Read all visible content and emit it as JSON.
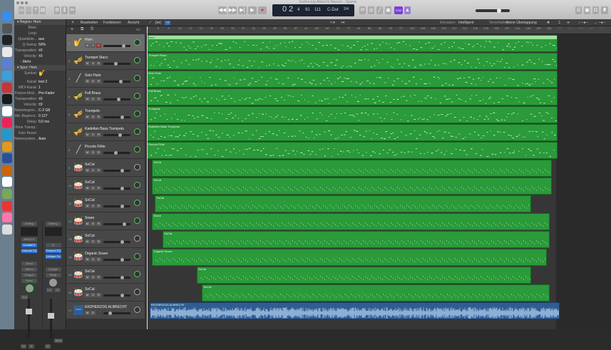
{
  "window": {
    "title": "Erzherzog Albrecht Marsch - Spuren"
  },
  "dock": {
    "icons": [
      "finder-icon",
      "system-preferences-icon",
      "app-icon",
      "app-icon",
      "app-icon",
      "app-icon",
      "app-icon",
      "app-icon",
      "app-icon",
      "app-icon",
      "app-icon",
      "app-icon",
      "app-icon",
      "app-icon",
      "app-icon",
      "app-icon",
      "app-icon",
      "app-icon",
      "trash-icon"
    ]
  },
  "transport": {
    "bar": "0",
    "beat": "2",
    "div": "4",
    "tick": "91",
    "tempo": "111",
    "key": "C-Dur",
    "signature": "2/4",
    "count_in": "1234"
  },
  "menu": {
    "edit": "Bearbeiten",
    "functions": "Funktionen",
    "view": "Ansicht",
    "snap_label": "Einrasten:",
    "snap_value": "Intelligent",
    "drag_label": "Verschieben:",
    "drag_value": "Keine Überlappung"
  },
  "inspector": {
    "region_header": "Region: Horn",
    "region_rows": [
      {
        "label": "Mute:",
        "value": ""
      },
      {
        "label": "Loop:",
        "value": ""
      },
      {
        "label": "Quantisier...",
        "value": "aus"
      },
      {
        "label": "Q-Swing:",
        "value": "50%"
      },
      {
        "label": "Transposition:",
        "value": "±0"
      },
      {
        "label": "Velocity:",
        "value": "±0"
      }
    ],
    "more": "Mehr",
    "track_header": "Spur: Horn",
    "track_rows": [
      {
        "label": "Symbol:",
        "value": ""
      },
      {
        "label": "Kanal:",
        "value": "Inst 2"
      },
      {
        "label": "MIDI-Kanal:",
        "value": "1"
      },
      {
        "label": "Freeze-Mod...",
        "value": "Pre-Fader"
      },
      {
        "label": "Transposition:",
        "value": "±0"
      },
      {
        "label": "Velocity:",
        "value": "±0"
      },
      {
        "label": "Notenbegren...",
        "value": "C-2   G8"
      },
      {
        "label": "Vel.-Begrenz.:",
        "value": "0   127"
      },
      {
        "label": "Delay:",
        "value": "0,0 ms"
      },
      {
        "label": "Ohne Transp.:",
        "value": ""
      },
      {
        "label": "Kein Reset:",
        "value": ""
      },
      {
        "label": "Notensystem...",
        "value": "Auto"
      }
    ],
    "strip1": {
      "setting": "Setting",
      "midi_fx": "MIDI-FX",
      "plugin1": "Kontakt 5",
      "plugin2": "Channel EQ",
      "send": "Send",
      "output": "Stereo",
      "group": "Gruppe",
      "automation": "Read",
      "vol": "-5,8",
      "pan": "",
      "mute": "M",
      "solo": "S"
    },
    "strip2": {
      "setting": "Setting",
      "plugin1": "Channel EQ",
      "plugin2": "(Unique Ou",
      "group": "Gruppe",
      "automation": "Read",
      "vol": "0,0",
      "pan": "-15",
      "mute": "M",
      "bounce": "Bnce"
    }
  },
  "ruler": [
    "1",
    "5",
    "9",
    "13",
    "17",
    "21",
    "25",
    "29",
    "33",
    "37",
    "41",
    "45",
    "49",
    "53",
    "57",
    "61",
    "65",
    "69",
    "73",
    "77",
    "81",
    "85",
    "89",
    "93",
    "97",
    "101",
    "105",
    "109",
    "113",
    "117",
    "121",
    "125",
    "129",
    "133",
    "137",
    "141",
    "145",
    "149",
    "153",
    "157",
    "161",
    "165",
    "169",
    "173"
  ],
  "tracks": [
    {
      "num": "2",
      "name": "Horn",
      "icon": "🎷",
      "type": "midi",
      "vol": 0.75,
      "pan_active": true,
      "rec": true,
      "selected": true,
      "region": {
        "name": "Horn",
        "start": 1,
        "end": 156
      }
    },
    {
      "num": "3",
      "name": "Trumpet Stacc",
      "icon": "🎺",
      "type": "midi",
      "vol": 0.45,
      "pan_active": true,
      "region": {
        "name": "Trumpet Stacc",
        "start": 1,
        "end": 156
      }
    },
    {
      "num": "4",
      "name": "Solo Flute",
      "icon": "╱",
      "type": "midi",
      "vol": 0.65,
      "pan_active": true,
      "region": {
        "name": "Solo Flute",
        "start": 1,
        "end": 156
      }
    },
    {
      "num": "5",
      "name": "Full Brass",
      "icon": "🎺",
      "type": "midi",
      "vol": 0.55,
      "pan_active": true,
      "region": {
        "name": "Full Brass",
        "start": 1,
        "end": 156
      }
    },
    {
      "num": "6",
      "name": "Trumpets",
      "icon": "🎺",
      "type": "midi",
      "vol": 0.7,
      "pan_active": true,
      "region": {
        "name": "Trumpets",
        "start": 1,
        "end": 156
      }
    },
    {
      "num": "7",
      "name": "Kadetten Bass Trumpets",
      "icon": "🎺",
      "type": "midi",
      "vol": 0.62,
      "pan_active": true,
      "region": {
        "name": "Kadetten Bass Trumpets",
        "start": 1,
        "end": 156
      }
    },
    {
      "num": "8",
      "name": "Piccolo Flöte",
      "icon": "╱",
      "type": "midi",
      "vol": 0.45,
      "pan_active": true,
      "region": {
        "name": "Piccolo Flöte",
        "start": 1,
        "end": 156
      }
    },
    {
      "num": "9",
      "name": "SoCal",
      "icon": "🥁",
      "type": "midi",
      "vol": 0.72,
      "pan_active": false,
      "region": {
        "name": "SoCal",
        "start": 3,
        "end": 154
      }
    },
    {
      "num": "10",
      "name": "SoCal",
      "icon": "🥁",
      "type": "midi",
      "vol": 0.72,
      "pan_active": true,
      "region": {
        "name": "SoCal",
        "start": 3,
        "end": 154
      }
    },
    {
      "num": "11",
      "name": "SoCal",
      "icon": "🥁",
      "type": "midi",
      "vol": 0.72,
      "pan_active": true,
      "region": {
        "name": "SoCal",
        "start": 4,
        "end": 146
      }
    },
    {
      "num": "12",
      "name": "Snare",
      "icon": "🥁",
      "type": "midi",
      "vol": 0.8,
      "pan_active": true,
      "region": {
        "name": "Snare",
        "start": 3,
        "end": 153
      }
    },
    {
      "num": "13",
      "name": "SoCal",
      "icon": "🥁",
      "type": "midi",
      "vol": 0.72,
      "pan_active": false,
      "region": {
        "name": "SoCal",
        "start": 7,
        "end": 153
      }
    },
    {
      "num": "14",
      "name": "Organic Snare",
      "icon": "🥁",
      "type": "midi",
      "vol": 0.72,
      "pan_active": true,
      "region": {
        "name": "Organic Snare",
        "start": 3,
        "end": 152
      }
    },
    {
      "num": "15",
      "name": "SoCal",
      "icon": "🥁",
      "type": "midi",
      "vol": 0.72,
      "pan_active": true,
      "region": {
        "name": "SoCal",
        "start": 20,
        "end": 146
      }
    },
    {
      "num": "16",
      "name": "SoCal",
      "icon": "🥁",
      "type": "midi",
      "vol": 0.72,
      "pan_active": false,
      "region": {
        "name": "SoCal",
        "start": 22,
        "end": 153
      }
    },
    {
      "num": "17",
      "name": "ERZHERZOG ALBRECHT",
      "icon": "〰",
      "type": "audio",
      "vol": 0.2,
      "pan_active": false,
      "region": {
        "name": "ERZHERZOG ALBRECHT",
        "start": 2,
        "end": 157
      }
    }
  ],
  "colors": {
    "midi_region": "#2a9a3a",
    "audio_region": "#2f5d93",
    "selected_track": "#6c6c6c"
  }
}
